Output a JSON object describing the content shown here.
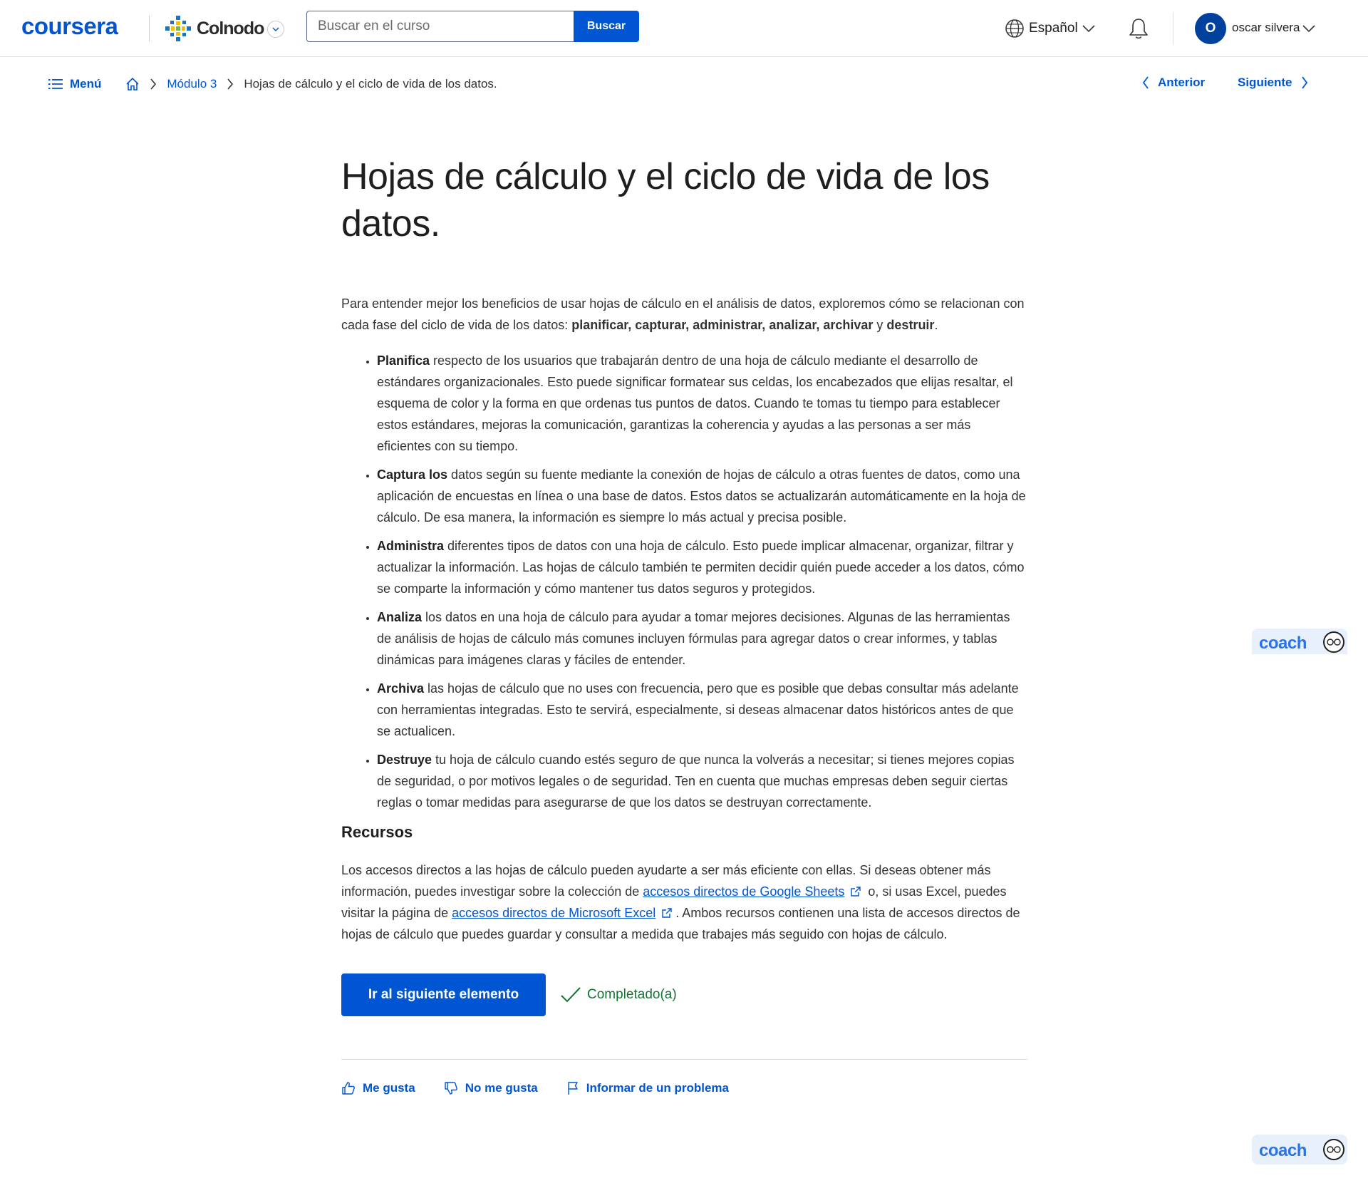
{
  "header": {
    "logo": "coursera",
    "partner_name": "Colnodo",
    "search_placeholder": "Buscar en el curso",
    "search_button": "Buscar",
    "language": "Español",
    "user_initial": "O",
    "user_name": "oscar silvera"
  },
  "breadcrumb": {
    "menu_label": "Menú",
    "module": "Módulo 3",
    "current": "Hojas de cálculo y el ciclo de vida de los datos.",
    "prev_label": "Anterior",
    "next_label": "Siguiente"
  },
  "article": {
    "title": "Hojas de cálculo y el ciclo de vida de los datos.",
    "intro_text": "Para entender mejor los beneficios de usar hojas de cálculo en el análisis de datos, exploremos cómo se relacionan con cada fase del ciclo de vida de los datos: ",
    "intro_phases": "planificar, capturar, administrar, analizar, archivar",
    "intro_and": " y ",
    "intro_last": "destruir",
    "intro_end": ".",
    "bullets": [
      {
        "lead": "Planifica",
        "text": " respecto de los usuarios que trabajarán dentro de una hoja de cálculo mediante el desarrollo de estándares organizacionales. Esto puede significar formatear sus celdas, los encabezados que elijas resaltar, el esquema de color y la forma en que ordenas tus puntos de datos. Cuando te tomas tu tiempo para establecer estos estándares, mejoras la comunicación, garantizas la coherencia y ayudas a las personas a ser más eficientes con su tiempo."
      },
      {
        "lead": "Captura los",
        "text": " datos según su fuente mediante la conexión de hojas de cálculo a otras fuentes de datos, como una aplicación de encuestas en línea o una base de datos. Estos datos se actualizarán automáticamente en la hoja de cálculo. De esa manera, la información es siempre lo más actual y precisa posible."
      },
      {
        "lead": "Administra",
        "text": " diferentes tipos de datos con una hoja de cálculo. Esto puede implicar almacenar, organizar, filtrar y actualizar la información. Las hojas de cálculo también te permiten decidir quién puede acceder a los datos, cómo se comparte la información y cómo mantener tus datos seguros y protegidos."
      },
      {
        "lead": "Analiza",
        "text": " los datos en una hoja de cálculo para ayudar a tomar mejores decisiones. Algunas de las herramientas de análisis de hojas de cálculo más comunes incluyen fórmulas para agregar datos o crear informes, y tablas dinámicas para imágenes claras y fáciles de entender."
      },
      {
        "lead": "Archiva",
        "text": " las hojas de cálculo que no uses con frecuencia, pero que es posible que debas consultar más adelante con herramientas integradas. Esto te servirá, especialmente, si deseas almacenar datos históricos antes de que se actualicen."
      },
      {
        "lead": "Destruye",
        "text": " tu hoja de cálculo cuando estés seguro de que nunca la volverás a necesitar; si tienes mejores copias de seguridad, o por motivos legales o de seguridad. Ten en cuenta que muchas empresas deben seguir ciertas reglas o tomar medidas para asegurarse de que los datos se destruyan correctamente."
      }
    ],
    "resources_title": "Recursos",
    "resources_p1": "Los accesos directos a las hojas de cálculo pueden ayudarte a ser más eficiente con ellas. Si deseas obtener más información, puedes investigar sobre la colección de ",
    "resources_link1": "accesos directos de Google Sheets",
    "resources_p2": " o, si usas Excel, puedes visitar la página de ",
    "resources_link2": "accesos directos de Microsoft Excel",
    "resources_p3": ". Ambos recursos contienen una lista de accesos directos de hojas de cálculo que puedes guardar y consultar a medida que trabajes más seguido con hojas de cálculo."
  },
  "actions": {
    "next_item": "Ir al siguiente elemento",
    "completed": "Completado(a)"
  },
  "feedback": {
    "like": "Me gusta",
    "dislike": "No me gusta",
    "report": "Informar de un problema"
  },
  "coach": {
    "label": "coach"
  }
}
